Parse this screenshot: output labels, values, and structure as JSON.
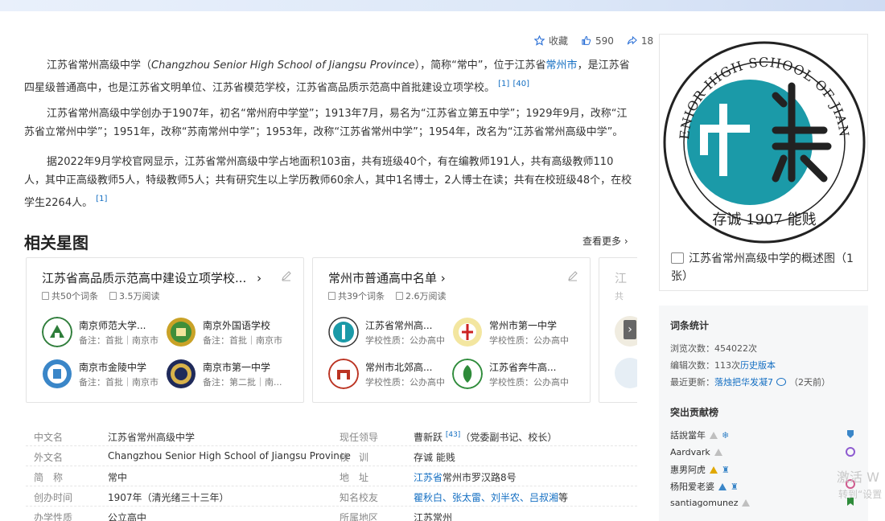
{
  "actions": {
    "collect": "收藏",
    "likes": "590",
    "shares": "18"
  },
  "intro": {
    "p1": {
      "a": "江苏省常州高级中学（",
      "en": "Changzhou Senior High School of Jiangsu Province",
      "b": "），简称“常中”，位于江苏省",
      "link": "常州市",
      "c": "，是江苏省四星级普通高中，也是江苏省文明单位、江苏省模范学校，江苏省高品质示范高中首批建设立项学校。",
      "ref1": "[1]",
      "ref2": "[40]"
    },
    "p2": "江苏省常州高级中学创办于1907年，初名“常州府中学堂”；1913年7月，易名为“江苏省立第五中学”；1929年9月，改称“江苏省立常州中学”；1951年，改称“苏南常州中学”；1953年，改称“江苏省常州中学”；1954年，改名为“江苏省常州高级中学”。",
    "p3": {
      "text": "据2022年9月学校官网显示，江苏省常州高级中学占地面积103亩，共有班级40个，有在编教师191人，共有高级教师110人，其中正高级教师5人，特级教师5人；共有研究生以上学历教师60余人，其中1名博士，2人博士在读；共有在校班级48个，在校学生2264人。",
      "ref": "[1]"
    }
  },
  "related": {
    "title": "相关星图",
    "see_more": "查看更多",
    "cards": [
      {
        "title": "江苏省高品质示范高中建设立项学校...",
        "count": "共50个词条",
        "reads": "3.5万阅读",
        "entries": [
          {
            "name": "南京师范大学...",
            "note": "备注：首批｜南京市"
          },
          {
            "name": "南京外国语学校",
            "note": "备注：首批｜南京市"
          },
          {
            "name": "南京市金陵中学",
            "note": "备注：首批｜南京市"
          },
          {
            "name": "南京市第一中学",
            "note": "备注：第二批｜南..."
          }
        ]
      },
      {
        "title": "常州市普通高中名单",
        "count": "共39个词条",
        "reads": "2.6万阅读",
        "entries": [
          {
            "name": "江苏省常州高...",
            "note": "学校性质：公办高中"
          },
          {
            "name": "常州市第一中学",
            "note": "学校性质：公办高中"
          },
          {
            "name": "常州市北郊高...",
            "note": "学校性质：公办高中"
          },
          {
            "name": "江苏省奔牛高...",
            "note": "学校性质：公办高中"
          }
        ]
      },
      {
        "title": "江",
        "count": "共",
        "reads": "",
        "entries": []
      }
    ]
  },
  "basic_info": {
    "rows": [
      {
        "k1": "中文名",
        "v1": "江苏省常州高级中学",
        "k2": "现任领导",
        "v2": "曹新跃",
        "v2ref": "[43]",
        "v2b": "（党委副书记、校长）"
      },
      {
        "k1": "外文名",
        "v1": "Changzhou Senior High School of Jiangsu Province",
        "k2": "校　训",
        "v2": "存诚 能贱",
        "v2ref": "",
        "v2b": ""
      },
      {
        "k1": "简　称",
        "v1": "常中",
        "k2": "地　址",
        "v2": "江苏省",
        "v2ref": "",
        "v2b": "常州市罗汉路8号"
      },
      {
        "k1": "创办时间",
        "v1": "1907年（清光绪三十三年）",
        "k2": "知名校友",
        "v2": "瞿秋白、张太雷、刘半农、吕叔湘",
        "v2ref": "",
        "v2b": "等"
      },
      {
        "k1": "办学性质",
        "v1": "公立高中",
        "k2": "所属地区",
        "v2": "江苏常州",
        "v2ref": "",
        "v2b": ""
      }
    ]
  },
  "album": {
    "caption": "江苏省常州高级中学的概述图（1张）",
    "logo_text": "CHANGZHOU SENIOR HIGH SCHOOL OF JIANGSU PROVINCE",
    "logo_bottom": "存诚 1907 能贱",
    "teal": "#1b9aa8"
  },
  "stats": {
    "title": "词条统计",
    "views": "浏览次数：454022次",
    "edits_a": "编辑次数：113次",
    "edits_link": "历史版本",
    "updated_a": "最近更新：",
    "updated_user": "落烛把华发凝7",
    "updated_b": "（2天前）",
    "contrib_title": "突出贡献榜",
    "contributors": [
      "話說當年",
      "Aardvark",
      "惠男阿虎",
      "杨阳爱老婆",
      "santiagomunez"
    ]
  },
  "watermark": {
    "line1": "激活 W",
    "line2": "转到“设置"
  }
}
